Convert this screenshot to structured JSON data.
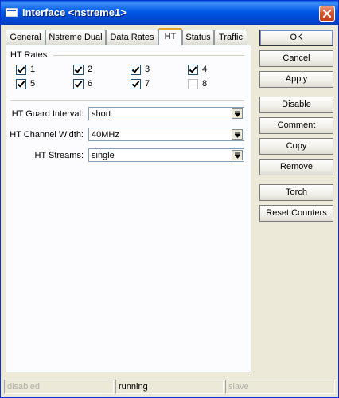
{
  "window": {
    "title": "Interface <nstreme1>",
    "icon": "window-icon",
    "close_icon": "close-icon"
  },
  "tabs": [
    {
      "label": "General"
    },
    {
      "label": "Nstreme Dual"
    },
    {
      "label": "Data Rates"
    },
    {
      "label": "HT",
      "active": true
    },
    {
      "label": "Status"
    },
    {
      "label": "Traffic"
    }
  ],
  "ht_rates": {
    "group_label": "HT Rates",
    "items": [
      {
        "label": "1",
        "checked": true
      },
      {
        "label": "2",
        "checked": true
      },
      {
        "label": "3",
        "checked": true
      },
      {
        "label": "4",
        "checked": true
      },
      {
        "label": "5",
        "checked": true
      },
      {
        "label": "6",
        "checked": true
      },
      {
        "label": "7",
        "checked": true
      },
      {
        "label": "8",
        "checked": false
      }
    ]
  },
  "fields": {
    "guard_interval": {
      "label": "HT Guard Interval:",
      "value": "short"
    },
    "channel_width": {
      "label": "HT Channel Width:",
      "value": "40MHz"
    },
    "streams": {
      "label": "HT Streams:",
      "value": "single"
    }
  },
  "buttons": {
    "ok": "OK",
    "cancel": "Cancel",
    "apply": "Apply",
    "disable": "Disable",
    "comment": "Comment",
    "copy": "Copy",
    "remove": "Remove",
    "torch": "Torch",
    "reset_counters": "Reset Counters"
  },
  "status": {
    "left": "disabled",
    "middle": "running",
    "right": "slave"
  },
  "colors": {
    "title_bar": "#0058e6",
    "active_tab_accent": "#e5a631",
    "window_bg": "#ece9d8"
  }
}
